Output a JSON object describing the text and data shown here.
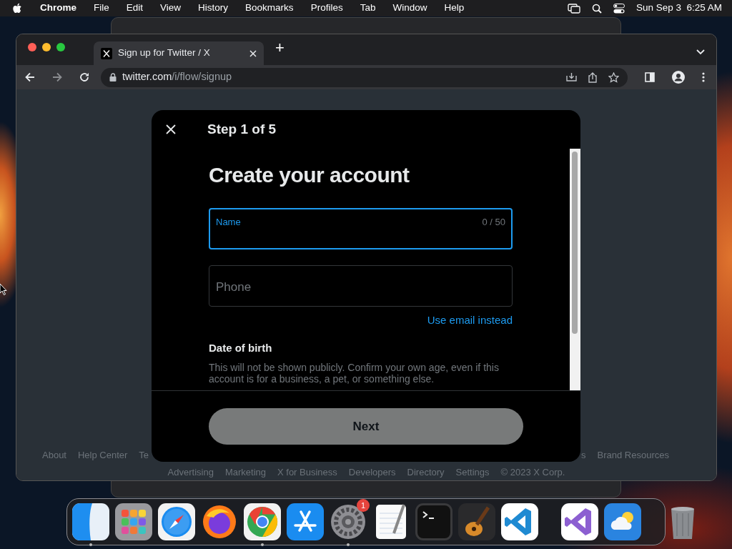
{
  "menu_bar": {
    "app": "Chrome",
    "menus": [
      "File",
      "Edit",
      "View",
      "History",
      "Bookmarks",
      "Profiles",
      "Tab",
      "Window",
      "Help"
    ],
    "clock": "Sun Sep 3  6:25 AM"
  },
  "browser": {
    "tabs": [
      {
        "title": "Sign up for Twitter / X",
        "selected": true
      }
    ],
    "new_tab": "+",
    "address": {
      "host": "twitter.com",
      "path": "/i/flow/signup"
    }
  },
  "modal": {
    "step": "Step 1 of 5",
    "heading": "Create your account",
    "fields": [
      {
        "label": "Name",
        "counter": "0 / 50",
        "focused": true
      },
      {
        "placeholder": "Phone",
        "focused": false
      }
    ],
    "link": "Use email instead",
    "dob_title": "Date of birth",
    "dob_text": "This will not be shown publicly. Confirm your own age, even if this account is for a business, a pet, or something else.",
    "next_button": {
      "label": "Next",
      "disabled": true
    }
  },
  "footer": {
    "row_1_left": [
      "About",
      "Help Center",
      "Te"
    ],
    "row_1_right": [
      "s",
      "Brand Resources"
    ],
    "row_2": [
      "Advertising",
      "Marketing",
      "X for Business",
      "Developers",
      "Directory",
      "Settings",
      "© 2023 X Corp."
    ]
  },
  "dock": {
    "apps": [
      {
        "kind": "finder",
        "running": true
      },
      {
        "kind": "launchpad",
        "running": false
      },
      {
        "kind": "safari",
        "running": false
      },
      {
        "kind": "firefox",
        "running": false
      },
      {
        "kind": "chrome",
        "running": true
      },
      {
        "kind": "appstore",
        "running": false
      },
      {
        "kind": "settings",
        "running": true,
        "badge": "1"
      },
      {
        "kind": "textedit",
        "running": false
      },
      {
        "kind": "terminal",
        "running": false
      },
      {
        "kind": "garageband",
        "running": false
      },
      {
        "kind": "vscode",
        "running": false
      },
      {
        "kind": "divider"
      },
      {
        "kind": "visualstudio",
        "running": false
      },
      {
        "kind": "weather",
        "running": false
      },
      {
        "kind": "divider"
      },
      {
        "kind": "trash",
        "running": false
      }
    ]
  }
}
